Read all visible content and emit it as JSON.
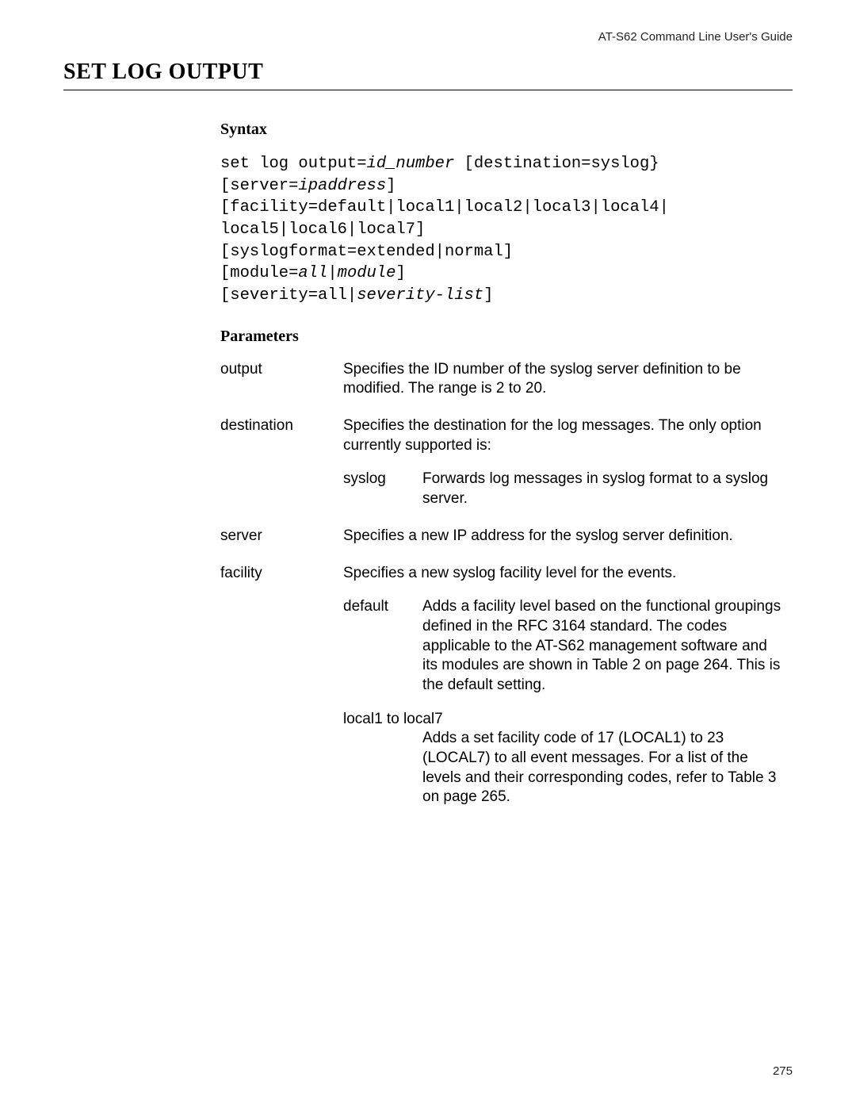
{
  "header": {
    "guide": "AT-S62 Command Line User's Guide"
  },
  "title": "SET LOG OUTPUT",
  "syntax": {
    "heading": "Syntax",
    "l1a": "set log output=",
    "l1b": "id_number",
    "l1c": " [destination=syslog}",
    "l2a": "[server=",
    "l2b": "ipaddress",
    "l2c": "]",
    "l3": "[facility=default|local1|local2|local3|local4|",
    "l4": "local5|local6|local7]",
    "l5": "[syslogformat=extended|normal]",
    "l6a": "[module=",
    "l6b": "all",
    "l6c": "|",
    "l6d": "module",
    "l6e": "]",
    "l7a": "[severity=all|",
    "l7b": "severity-list",
    "l7c": "]"
  },
  "parameters": {
    "heading": "Parameters",
    "rows": [
      {
        "name": "output",
        "desc": "Specifies the ID number of the syslog server definition to be modified. The range is 2 to 20."
      },
      {
        "name": "destination",
        "desc": "Specifies the destination for the log messages. The only option currently supported is:",
        "sub": [
          {
            "name": "syslog",
            "desc": "Forwards log messages in syslog format to a syslog server."
          }
        ]
      },
      {
        "name": "server",
        "desc": "Specifies a new IP address for the syslog server definition."
      },
      {
        "name": "facility",
        "desc": "Specifies a new syslog facility level for the events.",
        "sub": [
          {
            "name": "default",
            "desc": "Adds a facility level based on the functional groupings defined in the RFC 3164 standard. The codes applicable to the AT-S62 management software and its modules are shown in Table 2 on page 264. This is the default setting."
          },
          {
            "name": "local1 to local7",
            "desc": "Adds a set facility code of 17 (LOCAL1) to 23 (LOCAL7) to all event messages. For a list of the levels and their corresponding codes, refer to Table 3 on page 265.",
            "full": true
          }
        ]
      }
    ]
  },
  "page_number": "275"
}
